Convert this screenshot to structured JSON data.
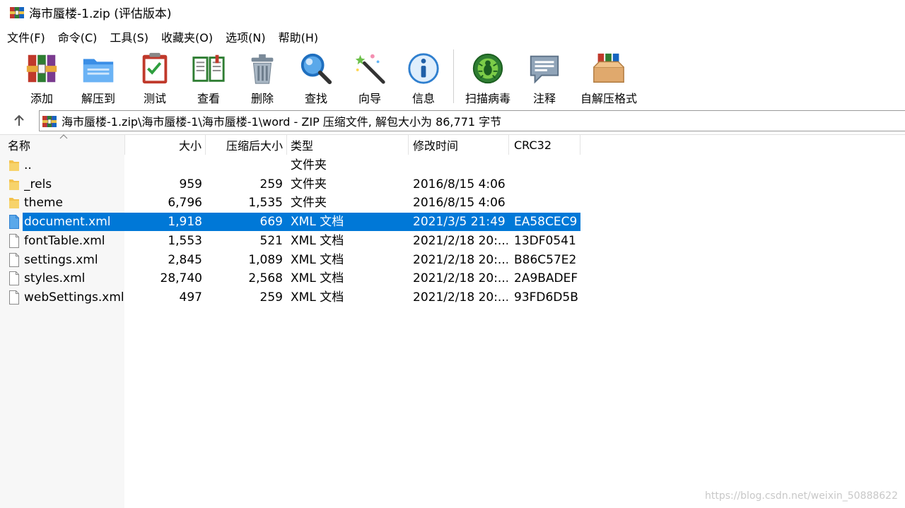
{
  "window": {
    "title": "海市蜃楼-1.zip (评估版本)"
  },
  "menu": [
    "文件(F)",
    "命令(C)",
    "工具(S)",
    "收藏夹(O)",
    "选项(N)",
    "帮助(H)"
  ],
  "toolbar": [
    {
      "label": "添加",
      "icon": "add-archive-icon"
    },
    {
      "label": "解压到",
      "icon": "extract-to-icon"
    },
    {
      "label": "测试",
      "icon": "test-icon"
    },
    {
      "label": "查看",
      "icon": "view-icon"
    },
    {
      "label": "删除",
      "icon": "delete-icon"
    },
    {
      "label": "查找",
      "icon": "find-icon"
    },
    {
      "label": "向导",
      "icon": "wizard-icon"
    },
    {
      "label": "信息",
      "icon": "info-icon"
    },
    {
      "label": "扫描病毒",
      "icon": "virus-scan-icon"
    },
    {
      "label": "注释",
      "icon": "comment-icon"
    },
    {
      "label": "自解压格式",
      "icon": "sfx-icon"
    }
  ],
  "address": {
    "path": "海市蜃楼-1.zip\\海市蜃楼-1\\海市蜃楼-1\\word - ZIP 压缩文件, 解包大小为 86,771 字节"
  },
  "columns": {
    "name": "名称",
    "size": "大小",
    "packed": "压缩后大小",
    "type": "类型",
    "modified": "修改时间",
    "crc": "CRC32"
  },
  "files": [
    {
      "name": "..",
      "size": "",
      "packed": "",
      "type": "文件夹",
      "modified": "",
      "crc": "",
      "kind": "folder"
    },
    {
      "name": "_rels",
      "size": "959",
      "packed": "259",
      "type": "文件夹",
      "modified": "2016/8/15 4:06",
      "crc": "",
      "kind": "folder"
    },
    {
      "name": "theme",
      "size": "6,796",
      "packed": "1,535",
      "type": "文件夹",
      "modified": "2016/8/15 4:06",
      "crc": "",
      "kind": "folder"
    },
    {
      "name": "document.xml",
      "size": "1,918",
      "packed": "669",
      "type": "XML 文档",
      "modified": "2021/3/5 21:49",
      "crc": "EA58CEC9",
      "kind": "file",
      "selected": true
    },
    {
      "name": "fontTable.xml",
      "size": "1,553",
      "packed": "521",
      "type": "XML 文档",
      "modified": "2021/2/18 20:...",
      "crc": "13DF0541",
      "kind": "file"
    },
    {
      "name": "settings.xml",
      "size": "2,845",
      "packed": "1,089",
      "type": "XML 文档",
      "modified": "2021/2/18 20:...",
      "crc": "B86C57E2",
      "kind": "file"
    },
    {
      "name": "styles.xml",
      "size": "28,740",
      "packed": "2,568",
      "type": "XML 文档",
      "modified": "2021/2/18 20:...",
      "crc": "2A9BADEF",
      "kind": "file"
    },
    {
      "name": "webSettings.xml",
      "size": "497",
      "packed": "259",
      "type": "XML 文档",
      "modified": "2021/2/18 20:...",
      "crc": "93FD6D5B",
      "kind": "file"
    }
  ],
  "watermark": "https://blog.csdn.net/weixin_50888622",
  "colors": {
    "selection": "#0078d7",
    "folder": "#f3c24d",
    "selected_file_icon": "#5aa8ea"
  }
}
